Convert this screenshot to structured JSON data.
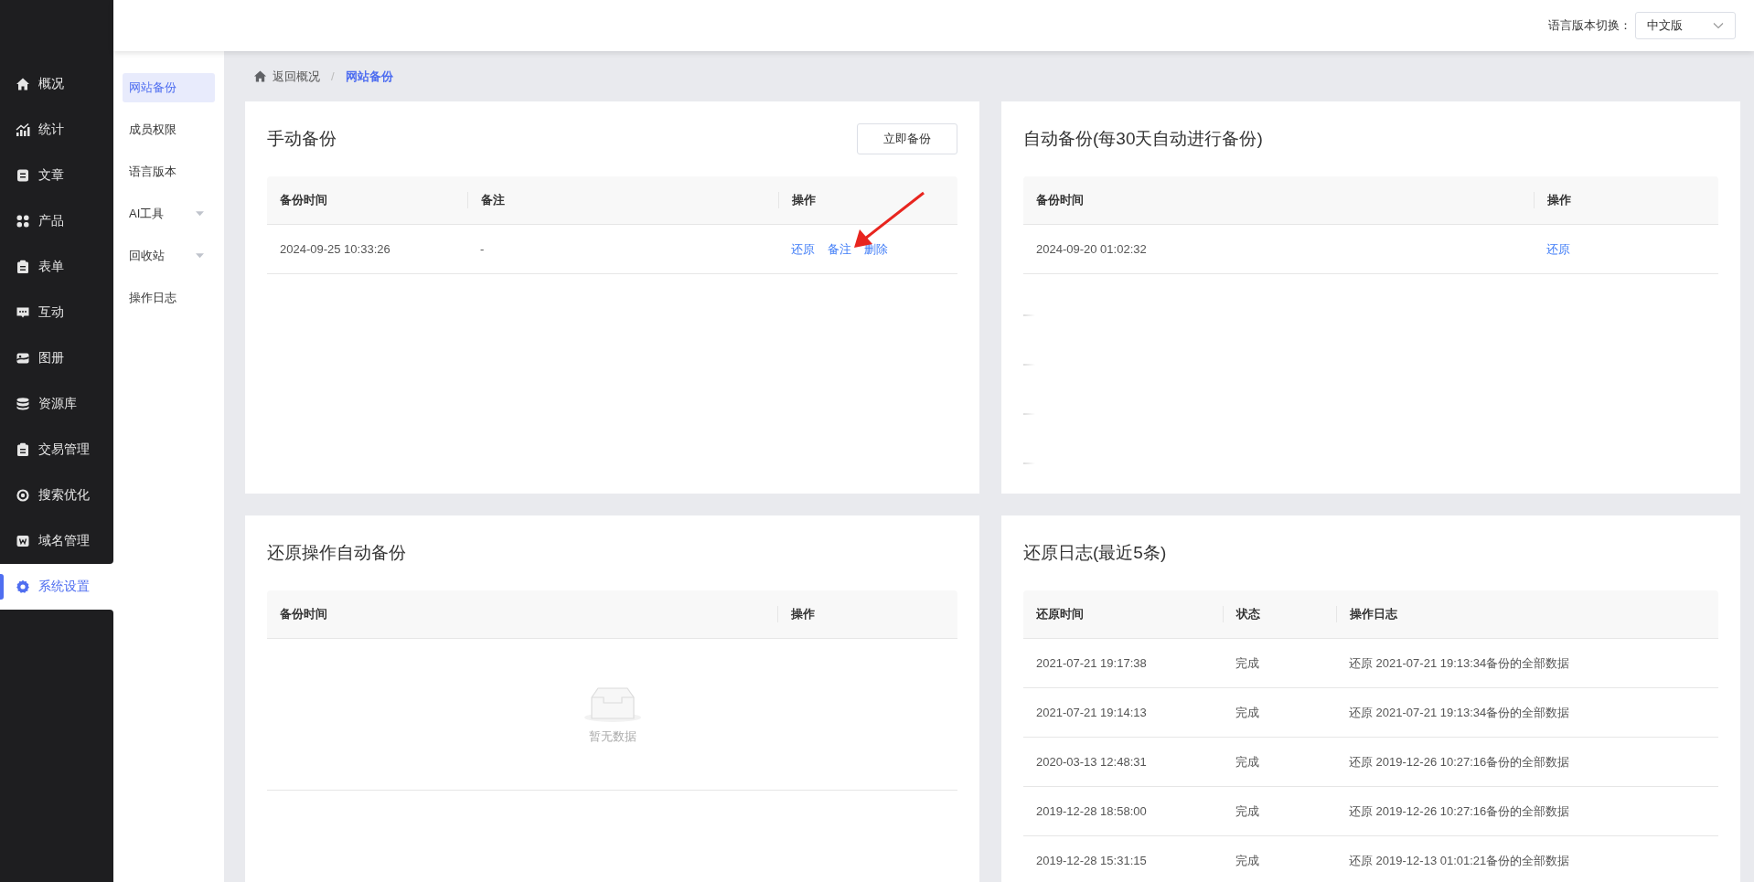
{
  "sidebar": {
    "items": [
      {
        "label": "概况",
        "selected": false
      },
      {
        "label": "统计",
        "selected": false
      },
      {
        "label": "文章",
        "selected": false
      },
      {
        "label": "产品",
        "selected": false
      },
      {
        "label": "表单",
        "selected": false
      },
      {
        "label": "互动",
        "selected": false
      },
      {
        "label": "图册",
        "selected": false
      },
      {
        "label": "资源库",
        "selected": false
      },
      {
        "label": "交易管理",
        "selected": false
      },
      {
        "label": "搜索优化",
        "selected": false
      },
      {
        "label": "域名管理",
        "selected": false
      },
      {
        "label": "系统设置",
        "selected": true
      }
    ]
  },
  "subnav": {
    "items": [
      {
        "label": "网站备份",
        "selected": true,
        "dropdown": false
      },
      {
        "label": "成员权限",
        "selected": false,
        "dropdown": false
      },
      {
        "label": "语言版本",
        "selected": false,
        "dropdown": false
      },
      {
        "label": "AI工具",
        "selected": false,
        "dropdown": true
      },
      {
        "label": "回收站",
        "selected": false,
        "dropdown": true
      },
      {
        "label": "操作日志",
        "selected": false,
        "dropdown": false
      }
    ]
  },
  "header": {
    "language_label": "语言版本切换：",
    "language_select": {
      "value": "中文版"
    }
  },
  "breadcrumb": {
    "back": "返回概况",
    "separator": "/",
    "current": "网站备份"
  },
  "manual_backup": {
    "title": "手动备份",
    "button": "立即备份",
    "columns": [
      "备份时间",
      "备注",
      "操作"
    ],
    "rows": [
      {
        "time": "2024-09-25 10:33:26",
        "note": "-",
        "actions": [
          "还原",
          "备注",
          "删除"
        ]
      }
    ]
  },
  "auto_backup": {
    "title": "自动备份(每30天自动进行备份)",
    "columns": [
      "备份时间",
      "操作"
    ],
    "rows": [
      {
        "time": "2024-09-20 01:02:32",
        "actions": [
          "还原"
        ]
      }
    ]
  },
  "restore_backup": {
    "title": "还原操作自动备份",
    "columns": [
      "备份时间",
      "操作"
    ],
    "empty_text": "暂无数据"
  },
  "restore_log": {
    "title": "还原日志(最近5条)",
    "columns": [
      "还原时间",
      "状态",
      "操作日志"
    ],
    "rows": [
      {
        "time": "2021-07-21 19:17:38",
        "status": "完成",
        "log": "还原 2021-07-21 19:13:34备份的全部数据"
      },
      {
        "time": "2021-07-21 19:14:13",
        "status": "完成",
        "log": "还原 2021-07-21 19:13:34备份的全部数据"
      },
      {
        "time": "2020-03-13 12:48:31",
        "status": "完成",
        "log": "还原 2019-12-26 10:27:16备份的全部数据"
      },
      {
        "time": "2019-12-28 18:58:00",
        "status": "完成",
        "log": "还原 2019-12-26 10:27:16备份的全部数据"
      },
      {
        "time": "2019-12-28 15:31:15",
        "status": "完成",
        "log": "还原 2019-12-13 01:01:21备份的全部数据"
      }
    ]
  }
}
